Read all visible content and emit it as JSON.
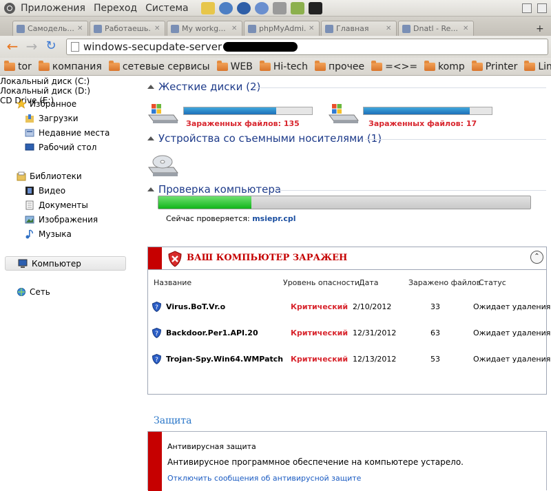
{
  "panel": {
    "menus": [
      "Приложения",
      "Переход",
      "Система"
    ]
  },
  "tabs": [
    {
      "label": "Самодель..."
    },
    {
      "label": "Работаешь..."
    },
    {
      "label": "My workg..."
    },
    {
      "label": "phpMyAdmi..."
    },
    {
      "label": "Главная"
    },
    {
      "label": "Dnatl - Re..."
    }
  ],
  "nav": {
    "url": "windows-secupdate-server"
  },
  "bookmarks": [
    "tor",
    "компания",
    "сетевые сервисы",
    "WEB",
    "Hi-tech",
    "прочее",
    "=<>=",
    "komp",
    "Printer",
    "Lin"
  ],
  "sidebar": {
    "favorites": {
      "label": "Избранное",
      "items": [
        "Загрузки",
        "Недавние места",
        "Рабочий стол"
      ]
    },
    "libraries": {
      "label": "Библиотеки",
      "items": [
        "Видео",
        "Документы",
        "Изображения",
        "Музыка"
      ]
    },
    "computer": "Компьютер",
    "network": "Сеть"
  },
  "hard_disks": {
    "heading": "Жесткие диски (2)",
    "drives": [
      {
        "name": "Локальный диск (C:)",
        "usage_fraction": 0.72,
        "infected": "Зараженных файлов: 135"
      },
      {
        "name": "Локальный диск (D:)",
        "usage_fraction": 0.83,
        "infected": "Зараженных файлов: 17"
      }
    ]
  },
  "removable": {
    "heading": "Устройства со съемными носителями (1)",
    "drive": "CD Drive (E:)"
  },
  "scan": {
    "heading": "Проверка компьютера",
    "progress_fraction": 0.25,
    "now_label": "Сейчас проверяется:",
    "now_file": "msiepr.cpl"
  },
  "alert": {
    "title": "ВАШ КОМПЬЮТЕР ЗАРАЖЕН",
    "columns": [
      "Название",
      "Уровень опасности",
      "Дата",
      "Заражено файлов",
      "Статус"
    ],
    "rows": [
      {
        "name": "Virus.BoT.Vr.o",
        "level": "Критический",
        "date": "2/10/2012",
        "count": "33",
        "status": "Ожидает удаления"
      },
      {
        "name": "Backdoor.Per1.API.20",
        "level": "Критический",
        "date": "12/31/2012",
        "count": "63",
        "status": "Ожидает удаления"
      },
      {
        "name": "Trojan-Spy.Win64.WMPatch",
        "level": "Критический",
        "date": "12/13/2012",
        "count": "53",
        "status": "Ожидает удаления"
      }
    ]
  },
  "protection": {
    "heading": "Защита",
    "title": "Антивирусная защита",
    "message": "Антивирусное программное обеспечение на компьютере устарело.",
    "link": "Отключить сообщения об антивирусной защите"
  }
}
